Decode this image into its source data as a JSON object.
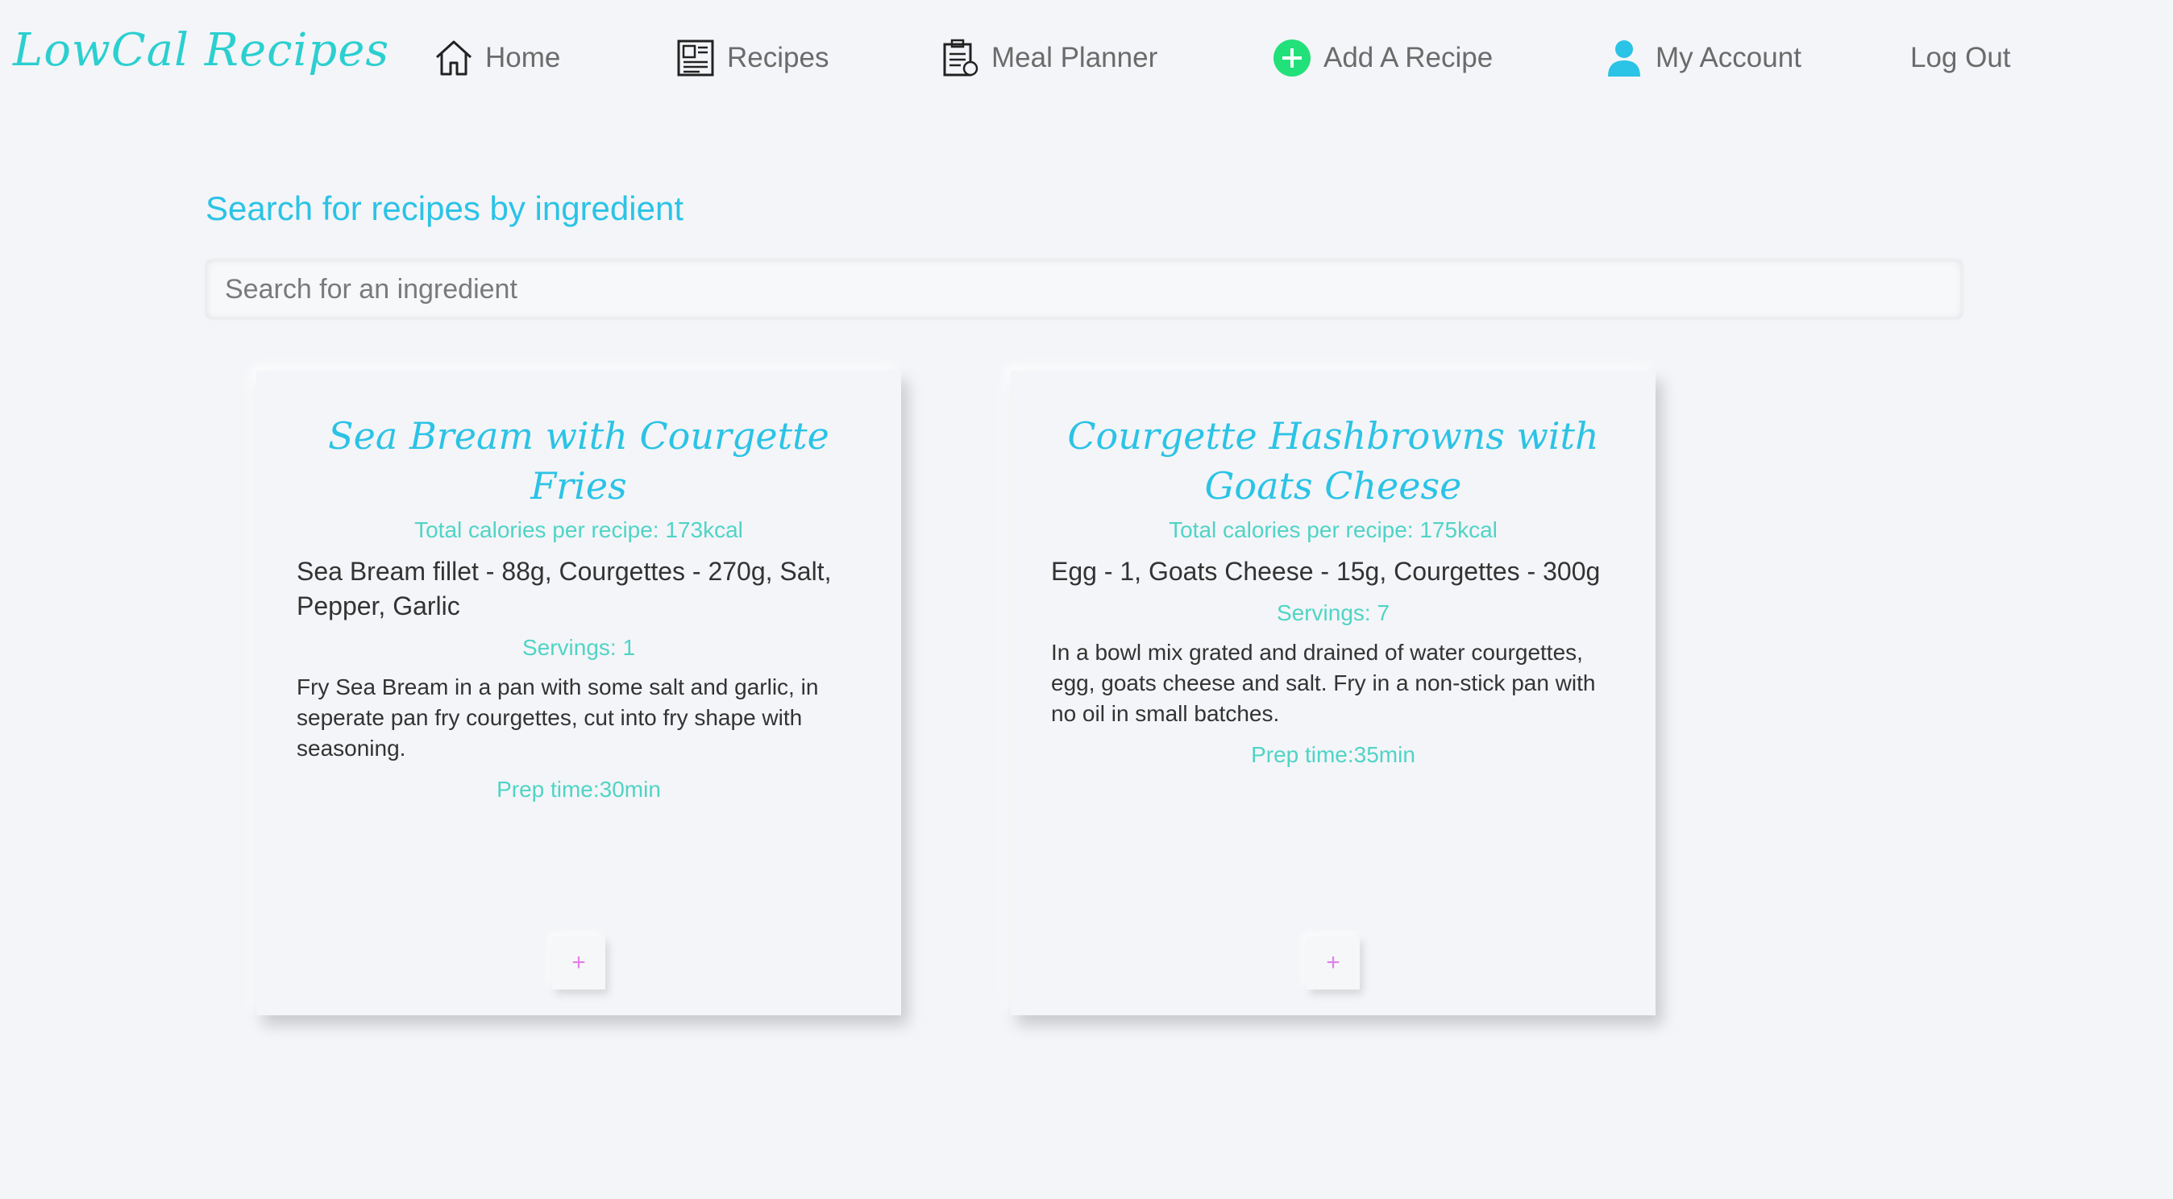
{
  "nav": {
    "logo": "LowCal Recipes",
    "home": "Home",
    "recipes": "Recipes",
    "meal_planner": "Meal Planner",
    "add_recipe": "Add A Recipe",
    "my_account": "My Account",
    "log_out": "Log Out"
  },
  "colors": {
    "accent": "#2bc3e6",
    "teal": "#4fd4c6",
    "add_icon": "#22e07a",
    "plus": "#e27fe8"
  },
  "search": {
    "title": "Search for recipes by ingredient",
    "placeholder": "Search for an ingredient",
    "value": ""
  },
  "recipes": [
    {
      "title": "Sea Bream with Courgette Fries",
      "calories": "Total calories per recipe: 173kcal",
      "ingredients": "Sea Bream fillet - 88g, Courgettes - 270g, Salt, Pepper, Garlic",
      "servings": "Servings: 1",
      "method": "Fry Sea Bream in a pan with some salt and garlic, in seperate pan fry courgettes, cut into fry shape with seasoning.",
      "prep": "Prep time:30min",
      "add_label": "+"
    },
    {
      "title": "Courgette Hashbrowns with Goats Cheese",
      "calories": "Total calories per recipe: 175kcal",
      "ingredients": "Egg - 1, Goats Cheese - 15g, Courgettes - 300g",
      "servings": "Servings: 7",
      "method": "In a bowl mix grated and drained of water courgettes, egg, goats cheese and salt. Fry in a non-stick pan with no oil in small batches.",
      "prep": "Prep time:35min",
      "add_label": "+"
    }
  ]
}
